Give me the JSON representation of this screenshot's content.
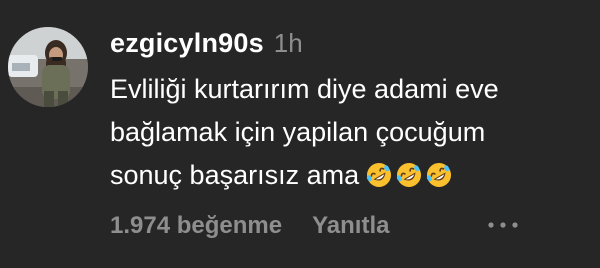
{
  "comment": {
    "username": "ezgicyln90s",
    "time": "1h",
    "lines": [
      "Evliliği kurtarırım diye adami eve",
      "bağlamak için yapilan çocuğum",
      "sonuç başarısız ama"
    ],
    "emojis": [
      "rolling-on-floor-laughing-icon",
      "rolling-on-floor-laughing-icon",
      "rolling-on-floor-laughing-icon"
    ],
    "likes_label": "1.974 beğenme",
    "reply_label": "Yanıtla",
    "more_icon": "more-dots-icon"
  },
  "colors": {
    "background": "#262626",
    "primary_text": "#ffffff",
    "secondary_text": "#8e8e8e",
    "emoji_face": "#fbc02d"
  }
}
